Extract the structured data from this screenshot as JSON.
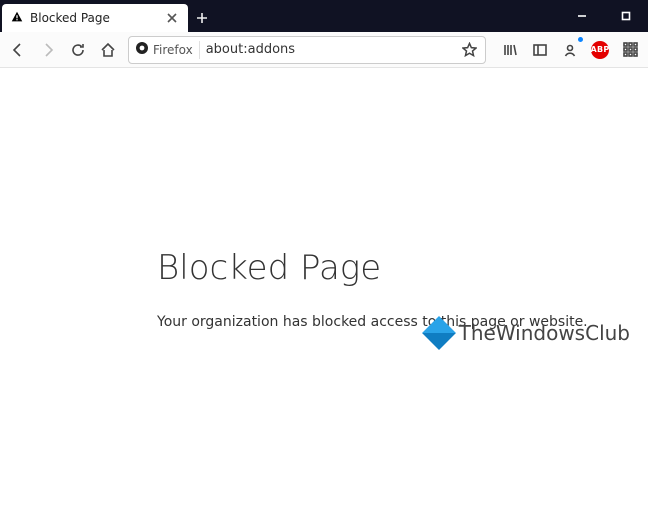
{
  "window": {
    "tab_title": "Blocked Page",
    "tab_icon": "warning-triangle"
  },
  "navbar": {
    "identity_label": "Firefox",
    "url": "about:addons"
  },
  "page": {
    "heading": "Blocked Page",
    "message": "Your organization has blocked access to this page or website."
  },
  "watermark": {
    "name": "TheWindowsClub"
  }
}
